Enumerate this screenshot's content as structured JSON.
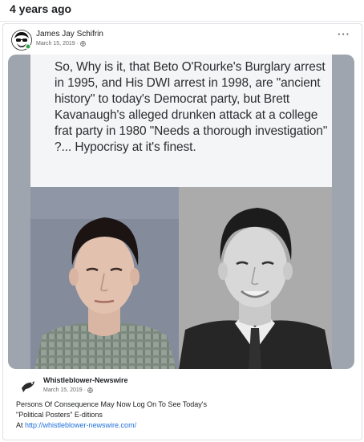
{
  "memory": {
    "label": "4 years ago"
  },
  "post": {
    "author": "James Jay Schifrin",
    "date": "March 15, 2019 · "
  },
  "image": {
    "quote": "So, Why is it, that Beto O'Rourke's Burglary arrest in 1995, and His DWI arrest in 1998, are \"ancient history\" to today's Democrat party, but Brett Kavanaugh's alleged drunken attack at a college frat party in 1980 \"Needs a thorough investigation\" ?... Hypocrisy at it's finest."
  },
  "shared": {
    "source": "Whistleblower-Newswire",
    "date": "March 15, 2019 · ",
    "line1": "Persons Of Consequence May Now Log On To See Today's",
    "line2": "\"Political Posters\" E-ditions",
    "at": "At ",
    "link": "http://whistleblower-newswire.com/"
  },
  "icons": {
    "more": "more-options-icon",
    "audience": "globe-icon"
  },
  "colors": {
    "link": "#216fdb",
    "meta": "#65676b",
    "panel": "#f4f5f6"
  }
}
